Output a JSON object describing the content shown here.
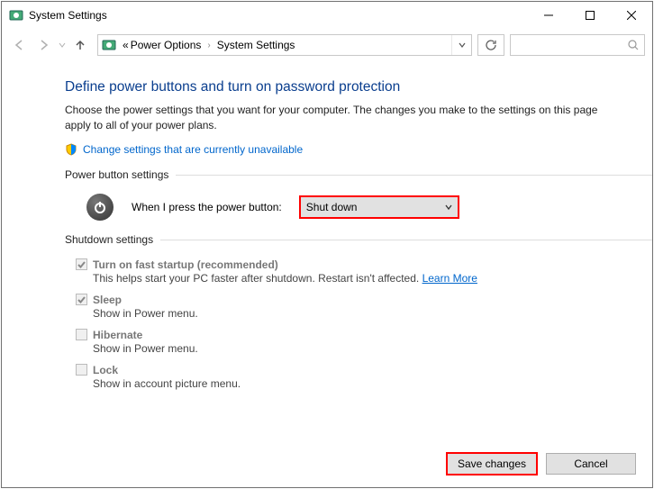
{
  "titlebar": {
    "title": "System Settings"
  },
  "breadcrumb": {
    "prefix": "«",
    "seg1": "Power Options",
    "seg2": "System Settings"
  },
  "heading": "Define power buttons and turn on password protection",
  "description": "Choose the power settings that you want for your computer. The changes you make to the settings on this page apply to all of your power plans.",
  "change_link": "Change settings that are currently unavailable",
  "groups": {
    "power_button": {
      "title": "Power button settings",
      "row_label": "When I press the power button:",
      "selected": "Shut down"
    },
    "shutdown": {
      "title": "Shutdown settings",
      "items": {
        "fast_startup": {
          "label": "Turn on fast startup (recommended)",
          "sub": "This helps start your PC faster after shutdown. Restart isn't affected. ",
          "link": "Learn More"
        },
        "sleep": {
          "label": "Sleep",
          "sub": "Show in Power menu."
        },
        "hibernate": {
          "label": "Hibernate",
          "sub": "Show in Power menu."
        },
        "lock": {
          "label": "Lock",
          "sub": "Show in account picture menu."
        }
      }
    }
  },
  "buttons": {
    "save": "Save changes",
    "cancel": "Cancel"
  }
}
